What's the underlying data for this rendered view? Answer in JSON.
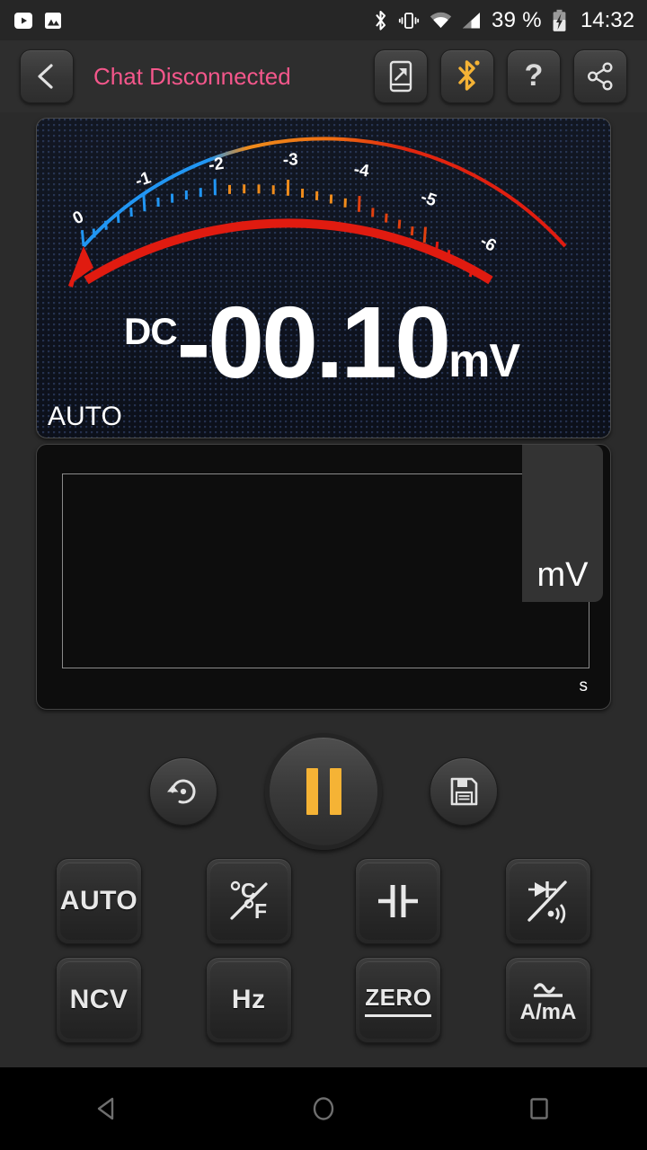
{
  "status_bar": {
    "left_icons": [
      {
        "name": "youtube-icon",
        "label": "YouTube"
      },
      {
        "name": "photos-icon",
        "label": "Photos"
      }
    ],
    "right_icons": [
      {
        "name": "bluetooth-icon",
        "label": "Bluetooth"
      },
      {
        "name": "vibrate-icon",
        "label": "Vibrate"
      },
      {
        "name": "wifi-icon",
        "label": "Wi-Fi"
      },
      {
        "name": "cell-signal-icon",
        "label": "Signal"
      }
    ],
    "battery_percent": "39 %",
    "battery_state": "charging",
    "clock": "14:32"
  },
  "toolbar": {
    "back_label": "Back",
    "title": "Chat Disconnected",
    "title_color": "#f4578b",
    "export_label": "Export",
    "bluetooth_label": "Bluetooth",
    "bluetooth_color": "#f5b335",
    "help_label": "Help",
    "share_label": "Share"
  },
  "meter": {
    "mode": "DC",
    "value": "-00.10",
    "unit": "mV",
    "range_mode": "AUTO",
    "needle_value": -0.1,
    "scale": {
      "labels": [
        "0",
        "-1",
        "-2",
        "-3",
        "-4",
        "-5",
        "-6"
      ],
      "min": 0,
      "max": -6,
      "band_colors": [
        "#2196f3",
        "#ef8c1c",
        "#e01b10"
      ],
      "needle_color": "#e01b10"
    }
  },
  "graph": {
    "y_axis_label": "mV",
    "x_axis_label": "s",
    "series": []
  },
  "transport": {
    "reset_label": "Reset",
    "pause_label": "Pause",
    "save_label": "Save",
    "accent_color": "#f5b335"
  },
  "keypad": {
    "rows": [
      [
        {
          "name": "auto-key",
          "label": "AUTO",
          "type": "text"
        },
        {
          "name": "temperature-unit-key",
          "label": "°C/°F",
          "type": "icon"
        },
        {
          "name": "capacitance-key",
          "label": "Capacitance",
          "type": "icon"
        },
        {
          "name": "diode-continuity-key",
          "label": "Diode / Continuity",
          "type": "icon"
        }
      ],
      [
        {
          "name": "ncv-key",
          "label": "NCV",
          "type": "text"
        },
        {
          "name": "frequency-key",
          "label": "Hz",
          "type": "text"
        },
        {
          "name": "zero-key",
          "label": "ZERO",
          "type": "text-underline"
        },
        {
          "name": "current-key",
          "label": "A/mA",
          "type": "icon"
        }
      ]
    ]
  },
  "navbar": {
    "back_label": "Back",
    "home_label": "Home",
    "recents_label": "Recents"
  }
}
